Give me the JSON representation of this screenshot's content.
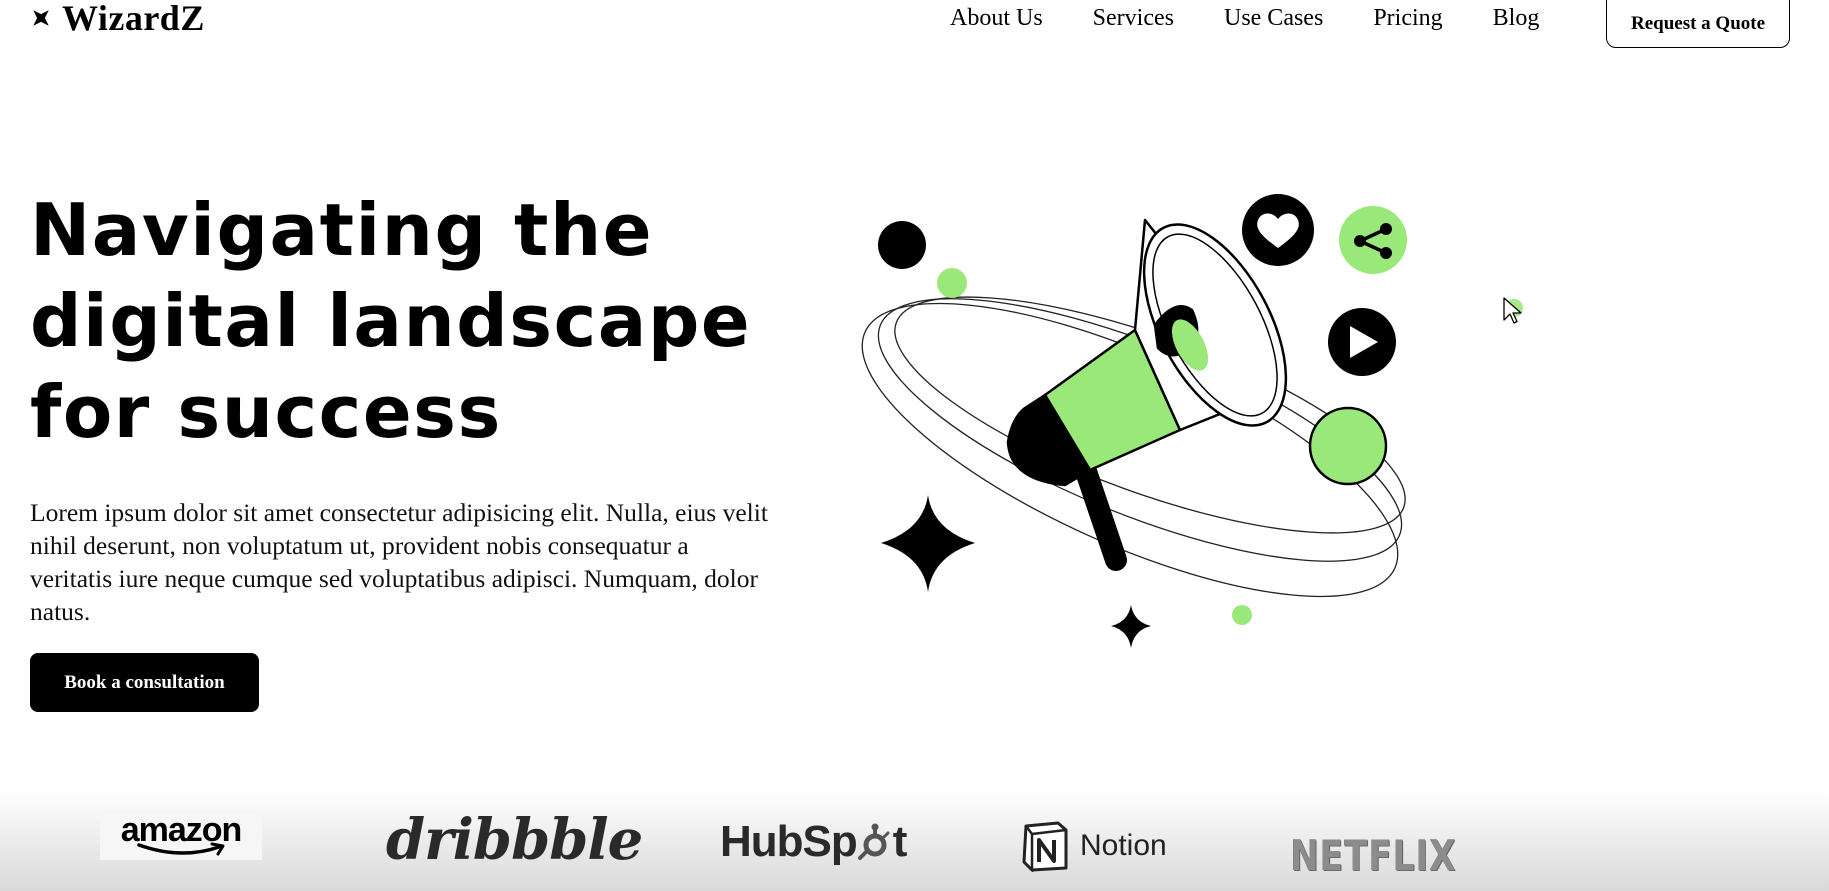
{
  "header": {
    "logo_text": "WizardZ",
    "nav": [
      "About Us",
      "Services",
      "Use Cases",
      "Pricing",
      "Blog"
    ],
    "quote_button": "Request a Quote"
  },
  "hero": {
    "title_lines": [
      "Navigating the",
      "digital landscape",
      "for success"
    ],
    "description": "Lorem ipsum dolor sit amet consectetur adipisicing elit. Nulla, eius velit nihil deserunt, non voluptatum ut, provident nobis consequatur a veritatis iure neque cumque sed voluptatibus adipisci. Numquam, dolor natus.",
    "cta": "Book a consultation"
  },
  "brands": {
    "amazon": "amazon",
    "dribbble": "dribbble",
    "hubspot_left": "HubSp",
    "hubspot_right": "t",
    "notion": "Notion",
    "netflix": "NETFLIX"
  },
  "colors": {
    "accent_green": "#9be87a",
    "text": "#000000",
    "background": "#ffffff"
  },
  "icons": [
    "heart-icon",
    "share-icon",
    "play-icon",
    "megaphone-illustration",
    "sparkle-star-icon"
  ]
}
